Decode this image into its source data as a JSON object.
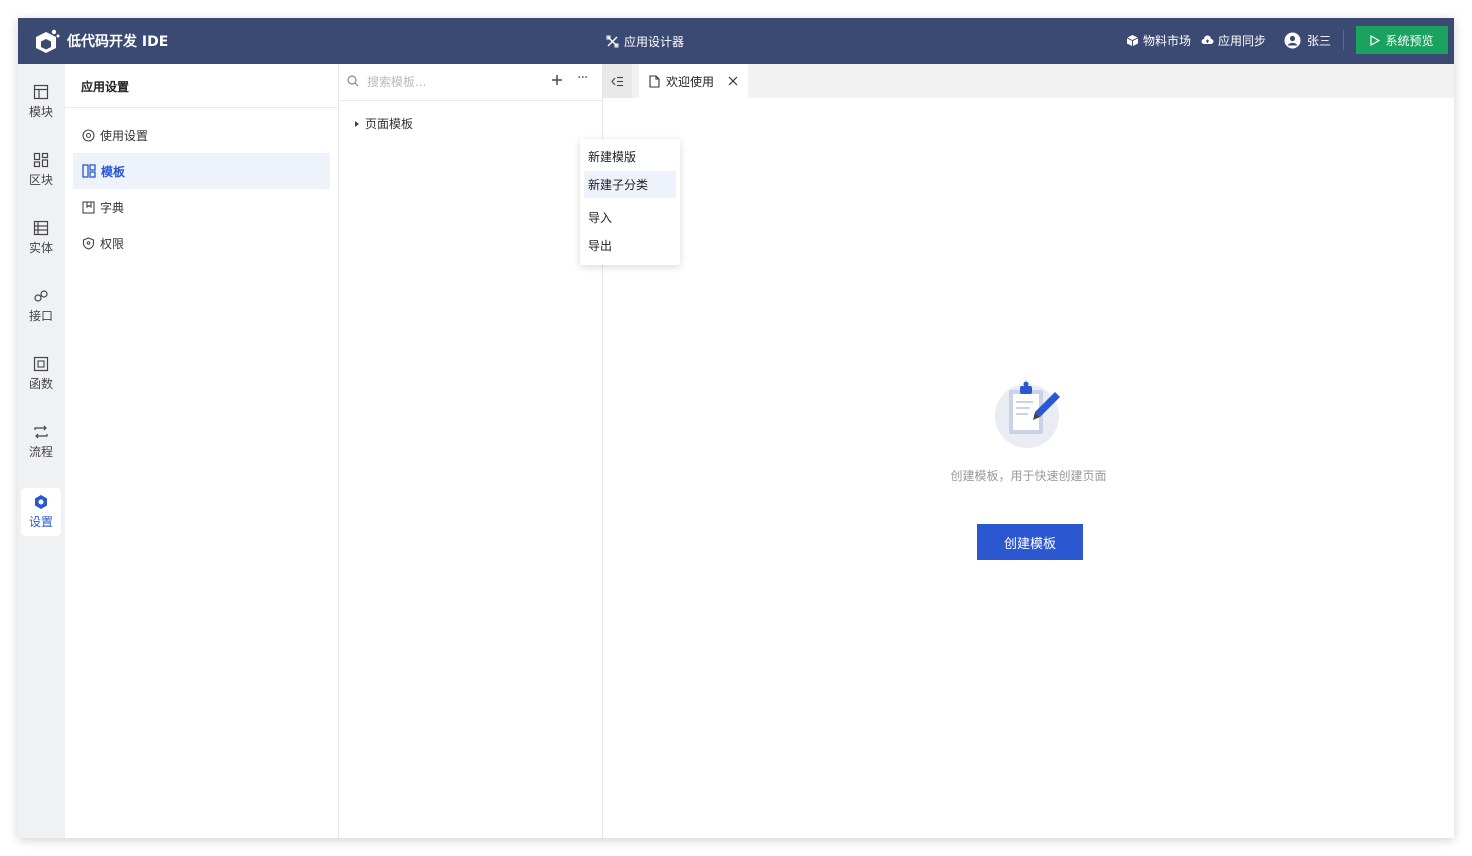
{
  "header": {
    "app_title": "低代码开发 IDE",
    "designer_label": "应用设计器",
    "links": [
      {
        "label": "物料市场",
        "icon": "cube-icon"
      },
      {
        "label": "应用同步",
        "icon": "cloud-sync-icon"
      }
    ],
    "user_name": "张三",
    "preview_label": "系统预览"
  },
  "rail": {
    "items": [
      {
        "label": "模块",
        "icon": "layout-icon"
      },
      {
        "label": "区块",
        "icon": "blocks-icon"
      },
      {
        "label": "实体",
        "icon": "entity-icon"
      },
      {
        "label": "接口",
        "icon": "link-icon"
      },
      {
        "label": "函数",
        "icon": "function-icon"
      },
      {
        "label": "流程",
        "icon": "flow-icon"
      },
      {
        "label": "设置",
        "icon": "settings-icon",
        "active": true
      }
    ]
  },
  "settings_nav": {
    "title": "应用设置",
    "items": [
      {
        "label": "使用设置",
        "icon": "gear-icon"
      },
      {
        "label": "模板",
        "icon": "template-icon",
        "active": true
      },
      {
        "label": "字典",
        "icon": "dictionary-icon"
      },
      {
        "label": "权限",
        "icon": "shield-icon"
      }
    ]
  },
  "template_panel": {
    "search_placeholder": "搜索模板...",
    "tree": [
      {
        "label": "页面模板",
        "expanded": false
      }
    ]
  },
  "context_menu": {
    "items": [
      {
        "label": "新建模版"
      },
      {
        "label": "新建子分类",
        "hovered": true
      },
      {
        "label": "导入"
      },
      {
        "label": "导出"
      }
    ]
  },
  "editor": {
    "tabs": [
      {
        "label": "欢迎使用",
        "icon": "file-icon",
        "active": true
      }
    ],
    "empty_text": "创建模板，用于快速创建页面",
    "create_button_label": "创建模板"
  },
  "colors": {
    "header_bg": "#3b4a72",
    "accent": "#2b57d1",
    "preview_green": "#19a35f"
  }
}
